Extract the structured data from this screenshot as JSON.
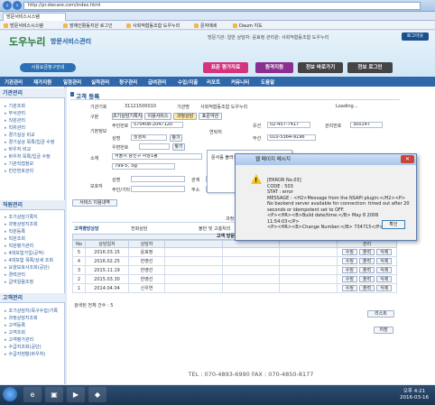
{
  "browser": {
    "url": "http://pr.dwcare.com/index.html",
    "tab_title": "방문서비스시스템",
    "bookmarks": [
      "방문서비스시스템",
      "장애인활동지원 로그인",
      "사회적협동조합 도우누리",
      "문자메세",
      "Daum 지도"
    ]
  },
  "header": {
    "logo": "도우누리",
    "logo_sub": "방문서비스관리",
    "user_info": "방문기관: 일반   상담자: 윤효정   관리원: 사회적협동조합 도우누리",
    "logout": "로그아웃",
    "affiliate_button": "사용요금청구안내",
    "buttons": [
      "표준 평가자료",
      "원격지원",
      "전보 바로가기",
      "전보 로그인"
    ]
  },
  "nav": [
    "기관관리",
    "재가지원",
    "일정관리",
    "실적관리",
    "청구관리",
    "급여관리",
    "수입/지출",
    "리포트",
    "커뮤니티",
    "도움말"
  ],
  "sidebar": {
    "sections": [
      {
        "title": "기관관리",
        "items": [
          "기관조회",
          "부서관리",
          "직원관리",
          "직위관리",
          "경기실상 비교",
          "경기실상 목록/입금 수정",
          "바우처 비교",
          "바우처 목록/입금 수정",
          "기관직접정보",
          "빈칸번호관리"
        ]
      },
      {
        "title": "직원관리",
        "items": [
          "조기상담기록지",
          "과정상담지조회",
          "직원등록",
          "직원조회",
          "직원평가관리",
          "4대보험가입(공적)",
          "4대보험 목록/상세 조회",
          "요양보호사조회(공단)",
          "경력관리",
          "급여일람조정"
        ]
      },
      {
        "title": "고객관리",
        "items": [
          "조기상담지(목구수집)기록",
          "과정상담지조회",
          "고객등록",
          "고객조회",
          "고객평가관리",
          "수급자조회(공단)",
          "수급자현황(바우처)"
        ]
      }
    ]
  },
  "page": {
    "title": "고객 등록",
    "fields": {
      "institution_code_label": "기관기호",
      "institution_code": "31121500010",
      "institution_name_label": "기관명",
      "institution_name": "사회적협동조합 도우누리",
      "loading": "Loading...",
      "category_label": "구분",
      "category_buttons": [
        "초기상담기록지",
        "이용서비스",
        "과정상담",
        "표준약관"
      ],
      "basic_info_label": "기본정보",
      "resident_no_label": "주민번호",
      "resident_no": "570408-2047120",
      "name_label": "성명",
      "name": "장영희",
      "search": "찾기",
      "contact_label": "연락처",
      "home_label": "유선",
      "home_phone": "02-457-7417",
      "mobile_label": "무선",
      "mobile_phone": "010-5364-9196",
      "mgmt_no_label": "관리번호",
      "mgmt_no": "300147",
      "address_label": "소재",
      "zip_label": "우편번호",
      "address": "서울시 광진구 자양1동",
      "address_detail": "799-5, 3층",
      "guardian_label": "보호자",
      "guardian_name_label": "성명",
      "guardian_relation_label": "관계",
      "guardian_resno_label": "주민/기타",
      "guardian_addr_label": "주소"
    },
    "service_btn": "서비스 이용내역",
    "counsel": {
      "header": "과정상담 내용",
      "row_labels": [
        "고객평방상담",
        "전화상담",
        "불만 및 고충처리"
      ]
    },
    "visit_section": "고객 방문상담 내역",
    "visit_table": {
      "columns": [
        "No",
        "상담일자",
        "상담자",
        "",
        "",
        "",
        "관리"
      ],
      "rows": [
        {
          "no": "5",
          "date": "2016.03.15",
          "counselor": "윤효정"
        },
        {
          "no": "4",
          "date": "2016.02.25",
          "counselor": "한영선"
        },
        {
          "no": "3",
          "date": "2015.11.19",
          "counselor": "한영선"
        },
        {
          "no": "2",
          "date": "2015.03.30",
          "counselor": "한영선"
        },
        {
          "no": "1",
          "date": "2014.04.04",
          "counselor": "신우연"
        }
      ],
      "row_buttons": [
        "수정",
        "출력",
        "삭제"
      ],
      "total": "검색된 전체 건수 : 5"
    },
    "list_btn": "리스트",
    "save_btn": "저장",
    "footer": "TEL : 070-4893-6990    FAX : 070-4850-8177"
  },
  "bg_popup_text": "문서를 불러오는 중",
  "dialog": {
    "title": "웹 페이지 메시지",
    "message": "[ERROR No.03]\nCODE : 503\nSTAT : error\nMESSAGE : <H2>Message from the NSAPI plugin:</H2><P>\nNo backend server available for connection: timed out after 20 seconds or idempotent set to OFF.\n<P><HR><B>Build date/time:</B> May 8 2006 11:54:03</P>\n<P><HR><B>Change Number:</B> 734715</P>",
    "ok": "확인"
  },
  "taskbar": {
    "time": "오후 4:21",
    "date": "2016-03-16"
  }
}
